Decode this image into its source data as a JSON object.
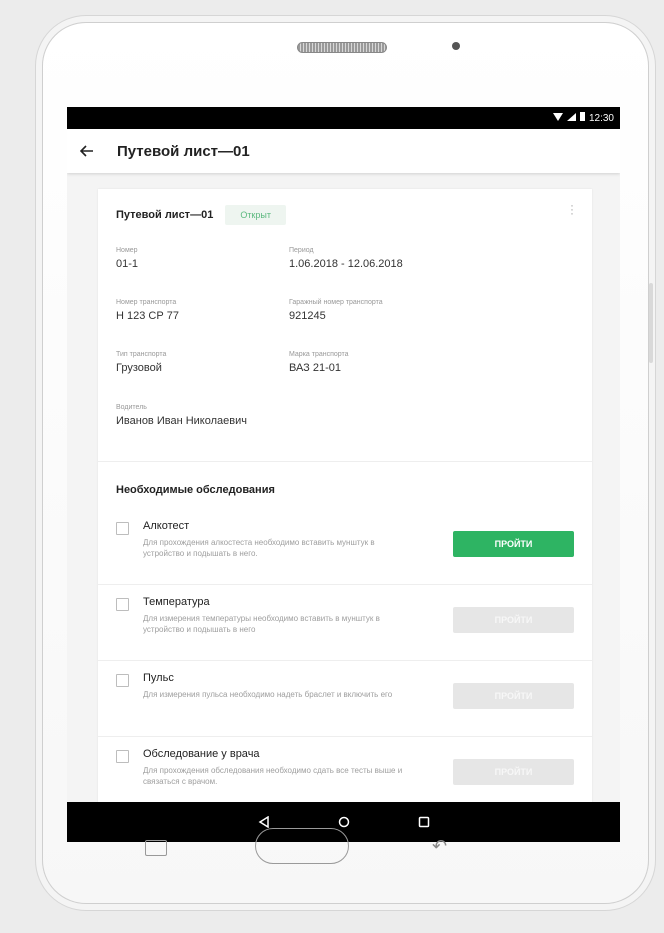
{
  "status_bar": {
    "time": "12:30"
  },
  "app_bar": {
    "title": "Путевой лист—01"
  },
  "card": {
    "title": "Путевой лист—01",
    "status_badge": "Открыт",
    "fields": {
      "number": {
        "label": "Номер",
        "value": "01-1"
      },
      "period": {
        "label": "Период",
        "value": "1.06.2018 - 12.06.2018"
      },
      "transport_number": {
        "label": "Номер транспорта",
        "value": "Н 123 СР 77"
      },
      "garage_number": {
        "label": "Гаражный номер транспорта",
        "value": "921245"
      },
      "transport_type": {
        "label": "Тип транспорта",
        "value": "Грузовой"
      },
      "transport_brand": {
        "label": "Марка транспорта",
        "value": "ВАЗ 21-01"
      },
      "driver": {
        "label": "Водитель",
        "value": "Иванов Иван Николаевич"
      }
    }
  },
  "exams": {
    "title": "Необходимые обследования",
    "items": [
      {
        "name": "Алкотест",
        "description": "Для прохождения алкостеста необходимо вставить мунштук в устройство и подышать в него.",
        "button": "ПРОЙТИ",
        "enabled": true
      },
      {
        "name": "Температура",
        "description": "Для измерения температуры необходимо вставить в мунштук в устройство и подышать в него",
        "button": "ПРОЙТИ",
        "enabled": false
      },
      {
        "name": "Пульс",
        "description": "Для измерения пульса необходимо надеть браслет и включить его",
        "button": "ПРОЙТИ",
        "enabled": false
      },
      {
        "name": "Обследование у врача",
        "description": "Для прохождения обследования необходимо сдать все тесты выше и связаться с врачом.",
        "button": "ПРОЙТИ",
        "enabled": false
      }
    ]
  },
  "colors": {
    "accent": "#2eb463",
    "badge_text": "#5cb97f",
    "badge_bg": "#eef5f0"
  }
}
